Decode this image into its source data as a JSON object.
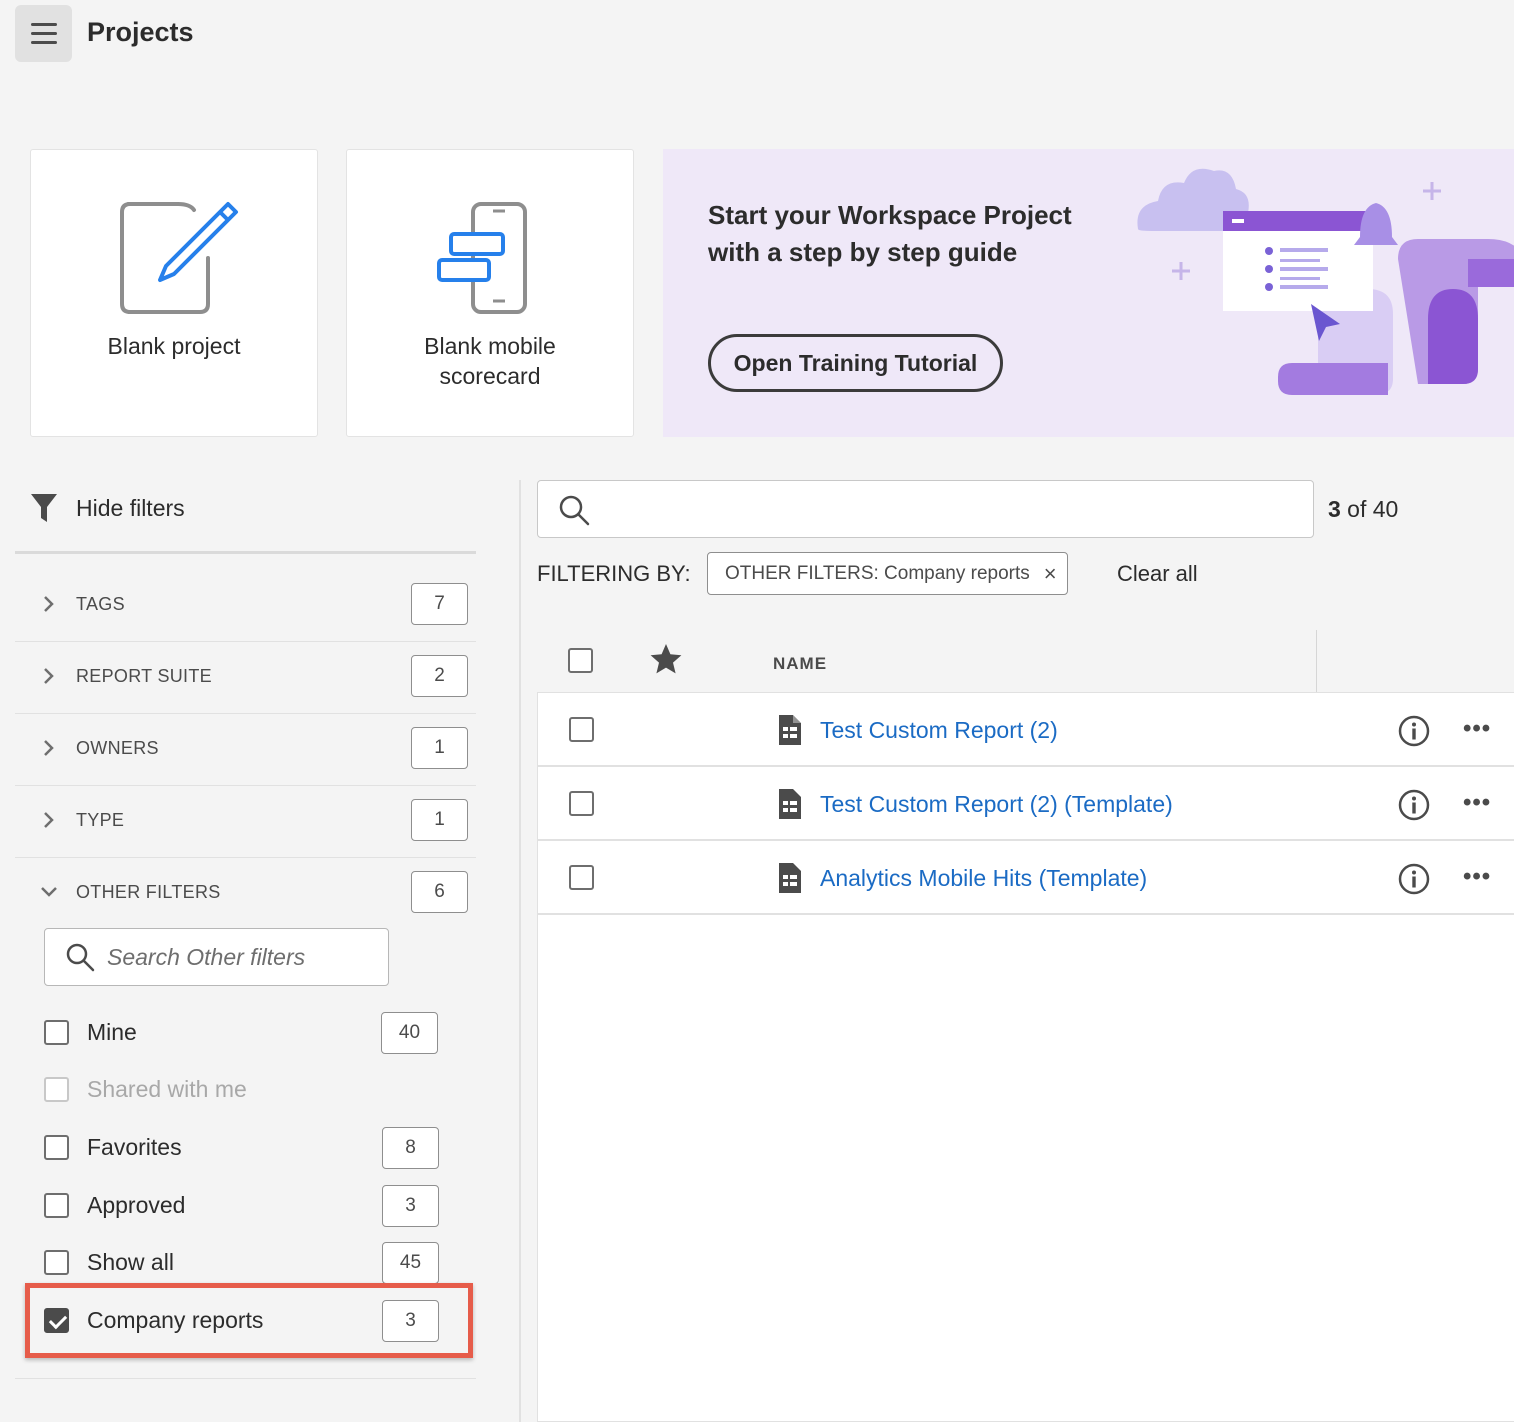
{
  "header": {
    "title": "Projects"
  },
  "cards": {
    "blank_project": "Blank project",
    "blank_mobile_line1": "Blank mobile",
    "blank_mobile_line2": "scorecard"
  },
  "promo": {
    "title_line1": "Start your Workspace Project",
    "title_line2": "with a step by step guide",
    "button": "Open Training Tutorial"
  },
  "filters": {
    "toggle_label": "Hide filters",
    "facets": [
      {
        "label": "TAGS",
        "count": "7"
      },
      {
        "label": "REPORT SUITE",
        "count": "2"
      },
      {
        "label": "OWNERS",
        "count": "1"
      },
      {
        "label": "TYPE",
        "count": "1"
      },
      {
        "label": "OTHER FILTERS",
        "count": "6"
      }
    ],
    "other_search_placeholder": "Search Other filters",
    "options": [
      {
        "label": "Mine",
        "count": "40"
      },
      {
        "label": "Shared with me",
        "count": ""
      },
      {
        "label": "Favorites",
        "count": "8"
      },
      {
        "label": "Approved",
        "count": "3"
      },
      {
        "label": "Show all",
        "count": "45"
      },
      {
        "label": "Company reports",
        "count": "3"
      }
    ]
  },
  "list": {
    "result_current": "3",
    "result_suffix": " of 40",
    "filtering_by": "FILTERING BY:",
    "chip_label": "OTHER FILTERS: Company reports",
    "chip_close": "×",
    "clear_all": "Clear all",
    "col_name": "NAME",
    "rows": [
      {
        "title": "Test Custom Report (2)"
      },
      {
        "title": "Test Custom Report (2) (Template)"
      },
      {
        "title": "Analytics Mobile Hits (Template)"
      }
    ],
    "more_glyph": "•••"
  },
  "colors": {
    "link": "#1b6bc4",
    "promo_bg": "#efe8f8",
    "highlight": "#e65c4a",
    "accent_blue": "#2680eb"
  }
}
